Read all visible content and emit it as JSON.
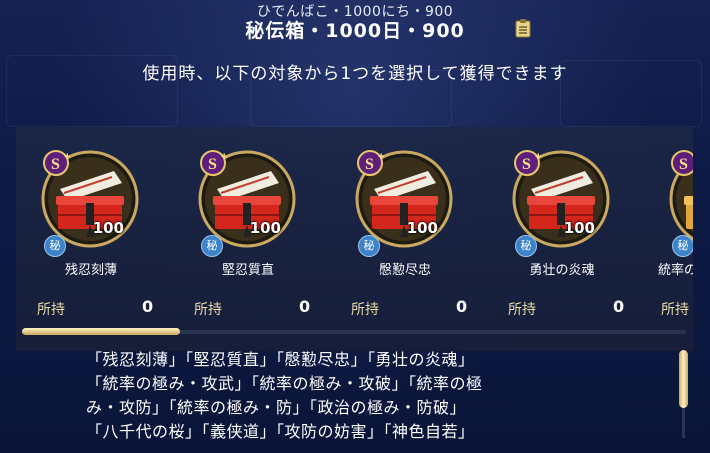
{
  "header": {
    "furigana": "ひでんばこ・1000にち・900",
    "title": "秘伝箱・1000日・900"
  },
  "subtitle": "使用時、以下の対象から1つを選択して獲得できます",
  "rarity_badge": "S+",
  "secret_mark": "秘",
  "owned_label": "所持",
  "items": [
    {
      "name": "残忍刻薄",
      "quantity": "100",
      "owned": "0"
    },
    {
      "name": "堅忍質直",
      "quantity": "100",
      "owned": "0"
    },
    {
      "name": "慇懃尽忠",
      "quantity": "100",
      "owned": "0"
    },
    {
      "name": "勇壮の炎魂",
      "quantity": "100",
      "owned": "0"
    },
    {
      "name": "統率の極",
      "quantity": "",
      "owned": ""
    }
  ],
  "description": [
    "「残忍刻薄」「堅忍質直」「慇懃尽忠」「勇壮の炎魂」",
    "「統率の極み・攻武」「統率の極み・攻破」「統率の極",
    "み・攻防」「統率の極み・防」「政治の極み・防破」",
    "「八千代の桜」「義侠道」「攻防の妨害」「神色自若」"
  ],
  "colors": {
    "background": "#0c1638",
    "panel": "#1c2646",
    "gold": "#c9a860",
    "chest_red": "#d4261d"
  },
  "icons": {
    "clipboard": "clipboard-icon",
    "item": "treasure-chest-icon"
  }
}
